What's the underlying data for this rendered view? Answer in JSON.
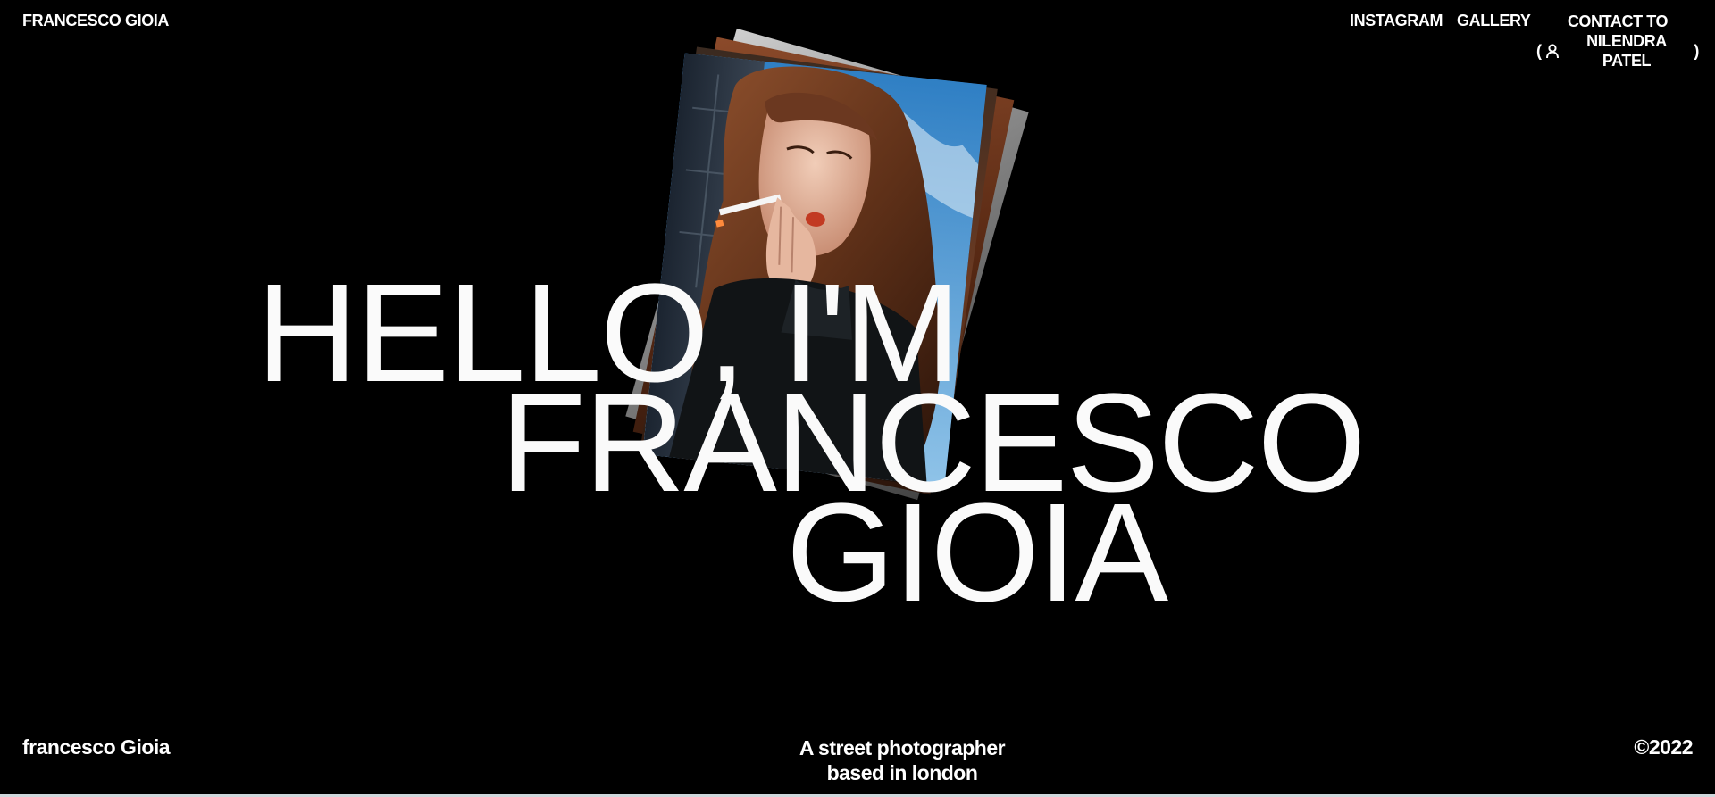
{
  "header": {
    "brand": "FRANCESCO GIOIA",
    "nav": {
      "instagram": "INSTAGRAM",
      "gallery": "GALLERY",
      "contact_line1": "CONTACT TO",
      "contact_open": "(",
      "contact_name": "NILENDRA PATEL",
      "contact_close": ")"
    },
    "contact_icon": "user-icon"
  },
  "hero": {
    "line1": "HELLO, I'M",
    "line2": "FRANCESCO",
    "line3": "GIOIA"
  },
  "photo": {
    "subject": "portrait of a woman smoking a cigarette against a blue sky"
  },
  "footer": {
    "name": "francesco Gioia",
    "tagline_line1": "A street photographer",
    "tagline_line2": "based in london",
    "copyright": "©2022"
  },
  "colors": {
    "background": "#000000",
    "text": "#ffffff"
  }
}
